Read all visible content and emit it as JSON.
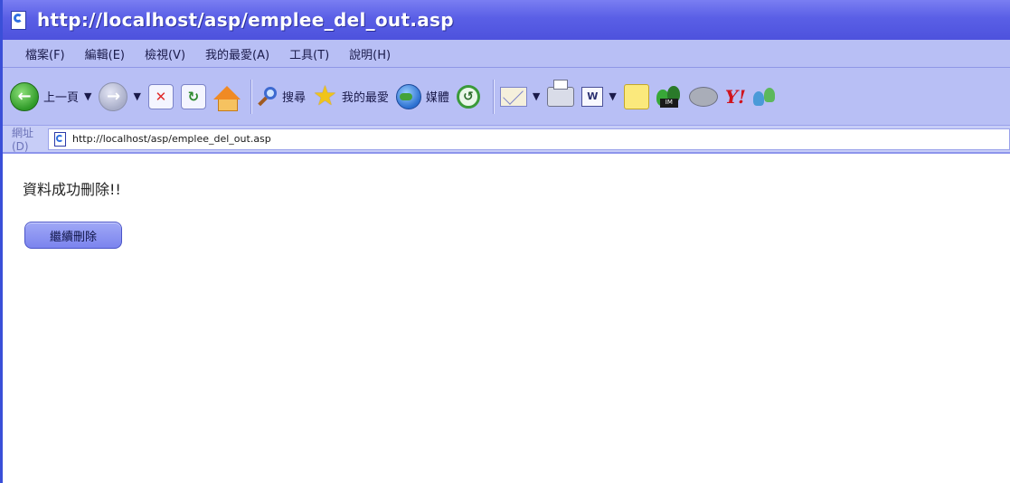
{
  "window": {
    "title": "http://localhost/asp/emplee_del_out.asp"
  },
  "menubar": {
    "items": [
      "檔案(F)",
      "編輯(E)",
      "檢視(V)",
      "我的最愛(A)",
      "工具(T)",
      "說明(H)"
    ]
  },
  "toolbar": {
    "back_label": "上一頁",
    "search_label": "搜尋",
    "favorites_label": "我的最愛",
    "media_label": "媒體"
  },
  "addressbar": {
    "label": "網址(D)",
    "url": "http://localhost/asp/emplee_del_out.asp"
  },
  "content": {
    "message": "資料成功刪除!!",
    "continue_button": "繼續刪除"
  },
  "colors": {
    "titlebar": "#5a5fe6",
    "chrome": "#b8bff5",
    "button": "#8f97f2"
  }
}
